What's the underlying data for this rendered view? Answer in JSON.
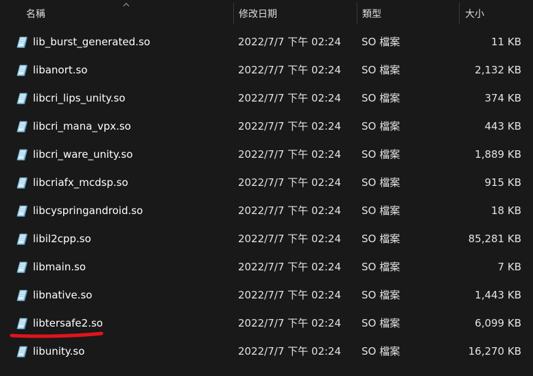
{
  "columns": {
    "name": "名稱",
    "date": "修改日期",
    "type": "類型",
    "size": "大小"
  },
  "files": [
    {
      "name": "lib_burst_generated.so",
      "date": "2022/7/7 下午 02:24",
      "type": "SO 檔案",
      "size": "11 KB"
    },
    {
      "name": "libanort.so",
      "date": "2022/7/7 下午 02:24",
      "type": "SO 檔案",
      "size": "2,132 KB"
    },
    {
      "name": "libcri_lips_unity.so",
      "date": "2022/7/7 下午 02:24",
      "type": "SO 檔案",
      "size": "374 KB"
    },
    {
      "name": "libcri_mana_vpx.so",
      "date": "2022/7/7 下午 02:24",
      "type": "SO 檔案",
      "size": "443 KB"
    },
    {
      "name": "libcri_ware_unity.so",
      "date": "2022/7/7 下午 02:24",
      "type": "SO 檔案",
      "size": "1,889 KB"
    },
    {
      "name": "libcriafx_mcdsp.so",
      "date": "2022/7/7 下午 02:24",
      "type": "SO 檔案",
      "size": "915 KB"
    },
    {
      "name": "libcyspringandroid.so",
      "date": "2022/7/7 下午 02:24",
      "type": "SO 檔案",
      "size": "18 KB"
    },
    {
      "name": "libil2cpp.so",
      "date": "2022/7/7 下午 02:24",
      "type": "SO 檔案",
      "size": "85,281 KB"
    },
    {
      "name": "libmain.so",
      "date": "2022/7/7 下午 02:24",
      "type": "SO 檔案",
      "size": "7 KB"
    },
    {
      "name": "libnative.so",
      "date": "2022/7/7 下午 02:24",
      "type": "SO 檔案",
      "size": "1,443 KB"
    },
    {
      "name": "libtersafe2.so",
      "date": "2022/7/7 下午 02:24",
      "type": "SO 檔案",
      "size": "6,099 KB"
    },
    {
      "name": "libunity.so",
      "date": "2022/7/7 下午 02:24",
      "type": "SO 檔案",
      "size": "16,270 KB"
    }
  ],
  "icons": {
    "file": "so-file-icon",
    "sort": "sort-up-chevron-icon"
  },
  "colors": {
    "background": "#191919",
    "text": "#ffffff",
    "annotation_underline": "#e0141b"
  }
}
